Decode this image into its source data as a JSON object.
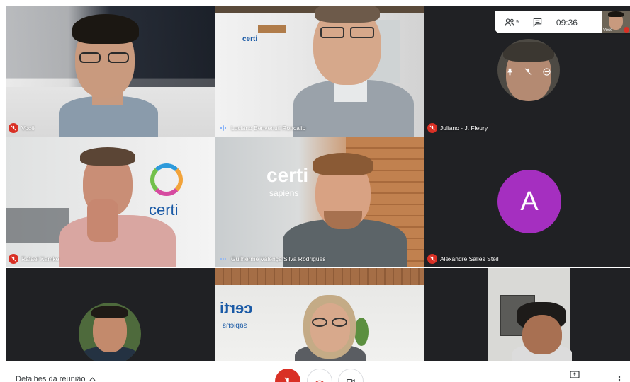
{
  "participants": [
    {
      "name": "Você",
      "muted": true
    },
    {
      "name": "Luciano Benvenuti Roncalio",
      "muted": false,
      "speaking": true
    },
    {
      "name": "Juliano - J. Fleury",
      "muted": true
    },
    {
      "name": "Rafael Kamke",
      "muted": true
    },
    {
      "name": "Guilherme Valença Silva Rodrigues",
      "muted": false,
      "speaking": true
    },
    {
      "name": "Alexandre Salles Steil",
      "muted": true,
      "avatar_letter": "A",
      "avatar_color": "#a52fc0"
    },
    {
      "name": "",
      "muted": false
    },
    {
      "name": "",
      "muted": false
    },
    {
      "name": "",
      "muted": false
    }
  ],
  "logos": {
    "certi": "certi",
    "certi_mirror": "certi",
    "sapiens": "sapiens"
  },
  "topbar": {
    "people_count": "9",
    "clock": "09:36",
    "self_label": "Você",
    "icons": [
      "people-icon",
      "chat-icon"
    ]
  },
  "bottombar": {
    "details_label": "Detalhes da reunião",
    "icons": [
      "chevron-up-icon",
      "mic-off-icon",
      "hangup-icon",
      "camera-icon",
      "present-icon",
      "more-icon"
    ]
  },
  "colors": {
    "muted_red": "#d93025",
    "tile_bg": "#202124",
    "accent_purple": "#a52fc0"
  }
}
